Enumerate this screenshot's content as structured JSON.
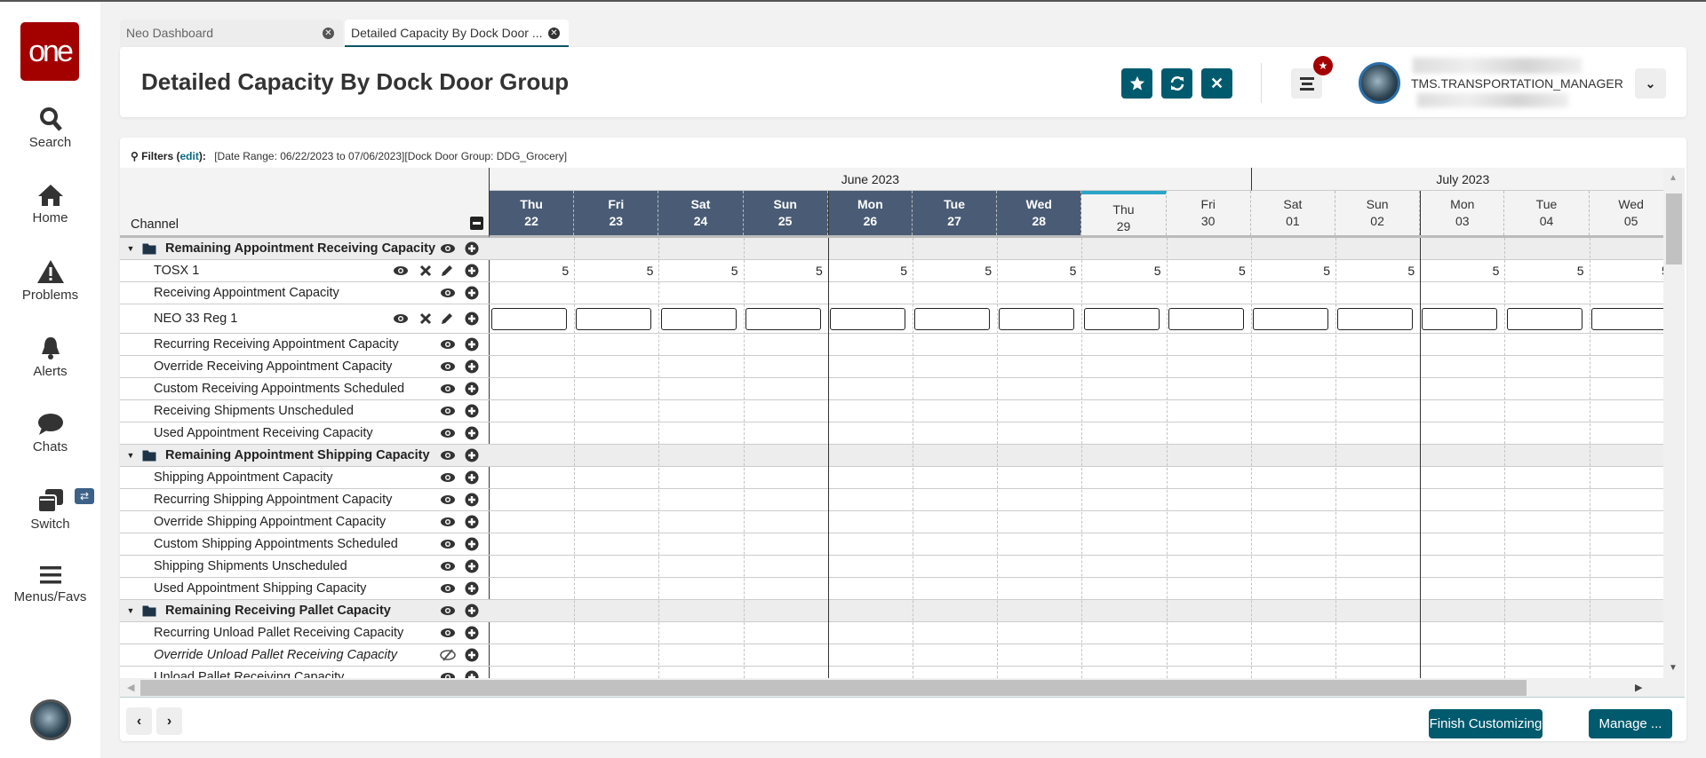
{
  "sidebar": {
    "logo": "one",
    "items": [
      {
        "label": "Search",
        "icon": "search-icon"
      },
      {
        "label": "Home",
        "icon": "home-icon"
      },
      {
        "label": "Problems",
        "icon": "warning-icon"
      },
      {
        "label": "Alerts",
        "icon": "bell-icon"
      },
      {
        "label": "Chats",
        "icon": "chat-icon"
      },
      {
        "label": "Switch",
        "icon": "windows-icon"
      },
      {
        "label": "Menus/Favs",
        "icon": "hamburger-icon"
      }
    ],
    "switch_badge": "⇄"
  },
  "tabs": [
    {
      "label": "Neo Dashboard",
      "active": false
    },
    {
      "label": "Detailed Capacity By Dock Door ...",
      "active": true
    }
  ],
  "header": {
    "title": "Detailed Capacity By Dock Door Group",
    "username": "TMS.TRANSPORTATION_MANAGER",
    "accent": "#005a6e",
    "badge_color": "#a30000"
  },
  "filters": {
    "label": "Filters",
    "edit": "edit",
    "text": "[Date Range: 06/22/2023 to 07/06/2023][Dock Door Group: DDG_Grocery]"
  },
  "grid": {
    "channel_header": "Channel",
    "months": [
      {
        "label": "June 2023",
        "days": 9
      },
      {
        "label": "July 2023",
        "days": 5
      }
    ],
    "days": [
      {
        "dow": "Thu",
        "date": "22",
        "state": "past"
      },
      {
        "dow": "Fri",
        "date": "23",
        "state": "past"
      },
      {
        "dow": "Sat",
        "date": "24",
        "state": "past"
      },
      {
        "dow": "Sun",
        "date": "25",
        "state": "past"
      },
      {
        "dow": "Mon",
        "date": "26",
        "state": "past"
      },
      {
        "dow": "Tue",
        "date": "27",
        "state": "past"
      },
      {
        "dow": "Wed",
        "date": "28",
        "state": "past"
      },
      {
        "dow": "Thu",
        "date": "29",
        "state": "today"
      },
      {
        "dow": "Fri",
        "date": "30",
        "state": "future"
      },
      {
        "dow": "Sat",
        "date": "01",
        "state": "future"
      },
      {
        "dow": "Sun",
        "date": "02",
        "state": "future"
      },
      {
        "dow": "Mon",
        "date": "03",
        "state": "future"
      },
      {
        "dow": "Tue",
        "date": "04",
        "state": "future"
      },
      {
        "dow": "Wed",
        "date": "05",
        "state": "future"
      }
    ],
    "rows": [
      {
        "type": "group",
        "label": "Remaining Appointment Receiving Capacity",
        "icons": [
          "eye",
          "plus"
        ]
      },
      {
        "type": "row",
        "label": "TOSX 1",
        "icons": [
          "eye",
          "x",
          "pencil",
          "plus"
        ],
        "values": [
          "5",
          "5",
          "5",
          "5",
          "5",
          "5",
          "5",
          "5",
          "5",
          "5",
          "5",
          "5",
          "5",
          "5"
        ]
      },
      {
        "type": "row",
        "label": "Receiving Appointment Capacity",
        "icons": [
          "eye",
          "plus"
        ]
      },
      {
        "type": "row",
        "label": "NEO 33 Reg 1",
        "icons": [
          "eye",
          "x",
          "pencil",
          "plus"
        ],
        "inputs": true
      },
      {
        "type": "row",
        "label": "Recurring Receiving Appointment Capacity",
        "icons": [
          "eye",
          "plus"
        ]
      },
      {
        "type": "row",
        "label": "Override Receiving Appointment Capacity",
        "icons": [
          "eye",
          "plus"
        ]
      },
      {
        "type": "row",
        "label": "Custom Receiving Appointments Scheduled",
        "icons": [
          "eye",
          "plus"
        ]
      },
      {
        "type": "row",
        "label": "Receiving Shipments Unscheduled",
        "icons": [
          "eye",
          "plus"
        ]
      },
      {
        "type": "row",
        "label": "Used Appointment Receiving Capacity",
        "icons": [
          "eye",
          "plus"
        ]
      },
      {
        "type": "group",
        "label": "Remaining Appointment Shipping Capacity",
        "icons": [
          "eye",
          "plus"
        ]
      },
      {
        "type": "row",
        "label": "Shipping Appointment Capacity",
        "icons": [
          "eye",
          "plus"
        ]
      },
      {
        "type": "row",
        "label": "Recurring Shipping Appointment Capacity",
        "icons": [
          "eye",
          "plus"
        ]
      },
      {
        "type": "row",
        "label": "Override Shipping Appointment Capacity",
        "icons": [
          "eye",
          "plus"
        ]
      },
      {
        "type": "row",
        "label": "Custom Shipping Appointments Scheduled",
        "icons": [
          "eye",
          "plus"
        ]
      },
      {
        "type": "row",
        "label": "Shipping Shipments Unscheduled",
        "icons": [
          "eye",
          "plus"
        ]
      },
      {
        "type": "row",
        "label": "Used Appointment Shipping Capacity",
        "icons": [
          "eye",
          "plus"
        ]
      },
      {
        "type": "group",
        "label": "Remaining Receiving Pallet Capacity",
        "icons": [
          "eye",
          "plus"
        ]
      },
      {
        "type": "row",
        "label": "Recurring Unload Pallet Receiving Capacity",
        "icons": [
          "eye",
          "plus"
        ]
      },
      {
        "type": "row",
        "label": "Override Unload Pallet Receiving Capacity",
        "icons": [
          "eye-slash",
          "plus"
        ],
        "italic": true
      },
      {
        "type": "row",
        "label": "Unload Pallet Receiving Capacity",
        "icons": [
          "eye",
          "plus"
        ]
      }
    ]
  },
  "footer": {
    "finish": "Finish Customizing",
    "manage": "Manage ..."
  }
}
